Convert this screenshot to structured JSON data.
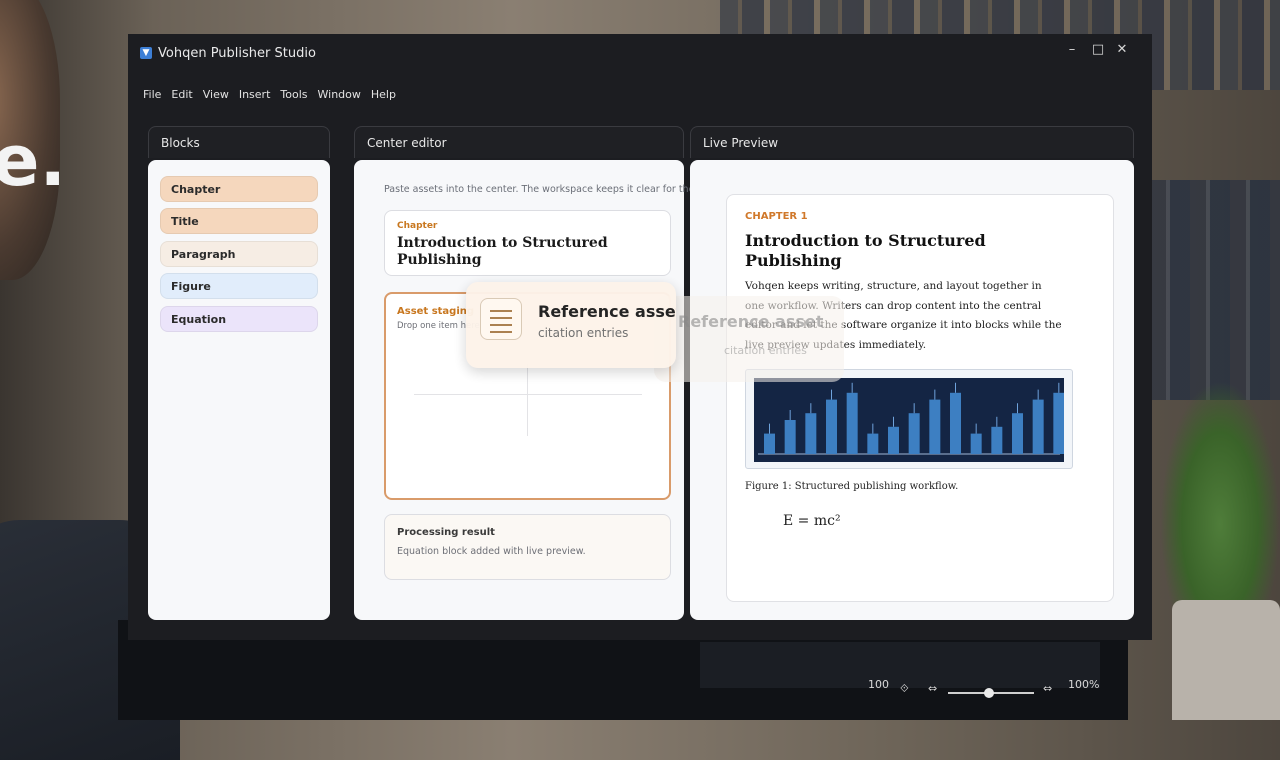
{
  "window": {
    "title": "Vohqen Publisher Studio"
  },
  "menu": [
    "File",
    "Edit",
    "View",
    "Insert",
    "Tools",
    "Window",
    "Help"
  ],
  "panels": {
    "blocks": {
      "title": "Blocks"
    },
    "center": {
      "title": "Center editor"
    },
    "preview": {
      "title": "Live Preview"
    }
  },
  "blocks": [
    {
      "label": "Chapter",
      "color": "#f5d7bd"
    },
    {
      "label": "Title",
      "color": "#f5d7bd"
    },
    {
      "label": "Paragraph",
      "color": "#f6ede4"
    },
    {
      "label": "Figure",
      "color": "#e1edfb"
    },
    {
      "label": "Equation",
      "color": "#ebe4fa"
    }
  ],
  "editor": {
    "hint": "Paste assets into the center. The workspace keeps it clear for the next item.",
    "chapter_card": {
      "label": "Chapter",
      "title": "Introduction to Structured Publishing"
    },
    "staging": {
      "label": "Asset staging",
      "hint": "Drop one item here"
    },
    "result": {
      "title": "Processing result",
      "text": "Equation block added with live preview."
    }
  },
  "drag": {
    "title": "Reference asset",
    "subtitle": "citation entries",
    "ghost_title": "Reference asset",
    "ghost_subtitle": "citation entries"
  },
  "preview": {
    "chapter_label": "CHAPTER 1",
    "title": "Introduction to Structured Publishing",
    "body": "Vohqen keeps writing, structure, and layout together in one workflow. Writers can drop content into the central editor and let the software organize it into blocks while the live preview updates immediately.",
    "caption": "Figure 1: Structured publishing workflow.",
    "equation": "E = mc²"
  },
  "chart_data": {
    "type": "bar",
    "values": [
      3,
      5,
      6,
      8,
      9,
      3,
      4,
      6,
      8,
      9,
      3,
      4,
      6,
      8,
      9
    ],
    "color": "#3d7fc2"
  },
  "status": {
    "left_zoom": "100",
    "right_zoom": "100%"
  },
  "background": {
    "letter": "e."
  }
}
